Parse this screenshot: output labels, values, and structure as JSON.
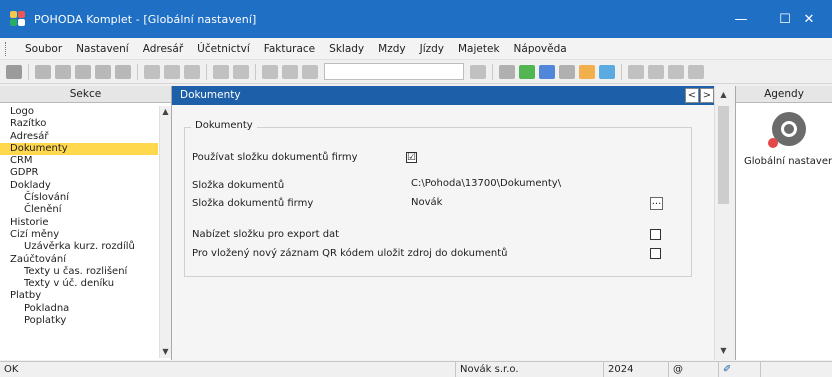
{
  "window": {
    "title": "POHODA Komplet - [Globální nastavení]",
    "minimize_glyph": "—",
    "maximize_glyph": "☐",
    "close_glyph": "✕",
    "title_bg": "#1f6fc5"
  },
  "menu": {
    "items": [
      {
        "label": "Soubor"
      },
      {
        "label": "Nastavení"
      },
      {
        "label": "Adresář"
      },
      {
        "label": "Účetnictví"
      },
      {
        "label": "Fakturace"
      },
      {
        "label": "Sklady"
      },
      {
        "label": "Mzdy"
      },
      {
        "label": "Jízdy"
      },
      {
        "label": "Majetek"
      },
      {
        "label": "Nápověda"
      }
    ]
  },
  "sections": {
    "header": "Sekce",
    "items": [
      {
        "label": "Logo",
        "level": 0
      },
      {
        "label": "Razítko",
        "level": 0
      },
      {
        "label": "Adresář",
        "level": 0
      },
      {
        "label": "Dokumenty",
        "level": 0,
        "selected": true
      },
      {
        "label": "CRM",
        "level": 0
      },
      {
        "label": "GDPR",
        "level": 0
      },
      {
        "label": "Doklady",
        "level": 0
      },
      {
        "label": "Číslování",
        "level": 1
      },
      {
        "label": "Členění",
        "level": 1
      },
      {
        "label": "Historie",
        "level": 0
      },
      {
        "label": "Cizí měny",
        "level": 0
      },
      {
        "label": "Uzávěrka kurz. rozdílů",
        "level": 1
      },
      {
        "label": "Zaúčtování",
        "level": 0
      },
      {
        "label": "Texty u čas. rozlišení",
        "level": 1
      },
      {
        "label": "Texty v úč. deníku",
        "level": 1
      },
      {
        "label": "Platby",
        "level": 0
      },
      {
        "label": "Pokladna",
        "level": 1
      },
      {
        "label": "Poplatky",
        "level": 1
      }
    ],
    "selected_color": "#ffd84d"
  },
  "document": {
    "header": "Dokumenty",
    "header_bg": "#1d5fa8",
    "nav_prev": "<",
    "nav_next": ">",
    "nav_up": "^",
    "group_title": "Dokumenty",
    "use_company_folder": {
      "label": "Používat složku dokumentů firmy",
      "checked": true,
      "mark": "☑"
    },
    "documents_folder": {
      "label": "Složka dokumentů",
      "value": "C:\\Pohoda\\13700\\Dokumenty\\"
    },
    "company_folder": {
      "label": "Složka dokumentů firmy",
      "value": "Novák",
      "button": "..."
    },
    "offer_export": {
      "label": "Nabízet složku pro export dat",
      "checked": false
    },
    "qr_source": {
      "label": "Pro vložený nový záznam QR kódem uložit zdroj do dokumentů",
      "checked": false
    }
  },
  "agendas": {
    "header": "Agendy",
    "item_label": "Globální nastavení"
  },
  "status": {
    "left": "OK",
    "company": "Novák  s.r.o.",
    "year": "2024",
    "at": "@",
    "pen": "✐"
  }
}
